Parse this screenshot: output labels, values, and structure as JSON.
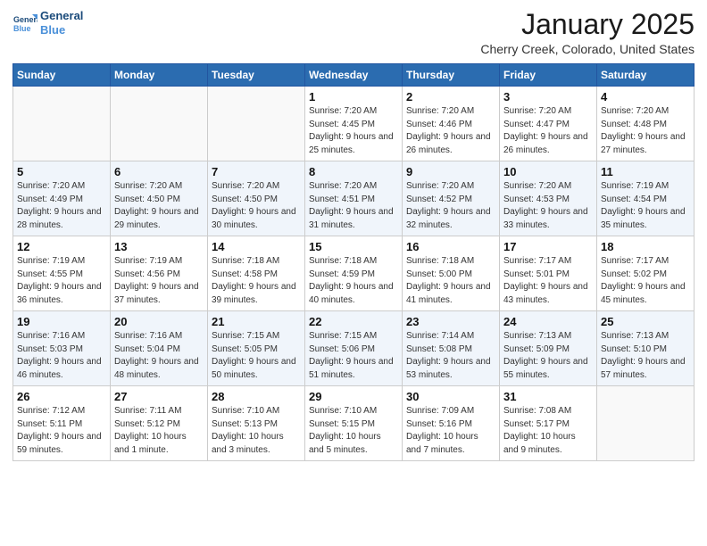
{
  "header": {
    "logo_line1": "General",
    "logo_line2": "Blue",
    "month": "January 2025",
    "location": "Cherry Creek, Colorado, United States"
  },
  "weekdays": [
    "Sunday",
    "Monday",
    "Tuesday",
    "Wednesday",
    "Thursday",
    "Friday",
    "Saturday"
  ],
  "weeks": [
    [
      {
        "day": "",
        "info": ""
      },
      {
        "day": "",
        "info": ""
      },
      {
        "day": "",
        "info": ""
      },
      {
        "day": "1",
        "info": "Sunrise: 7:20 AM\nSunset: 4:45 PM\nDaylight: 9 hours and 25 minutes."
      },
      {
        "day": "2",
        "info": "Sunrise: 7:20 AM\nSunset: 4:46 PM\nDaylight: 9 hours and 26 minutes."
      },
      {
        "day": "3",
        "info": "Sunrise: 7:20 AM\nSunset: 4:47 PM\nDaylight: 9 hours and 26 minutes."
      },
      {
        "day": "4",
        "info": "Sunrise: 7:20 AM\nSunset: 4:48 PM\nDaylight: 9 hours and 27 minutes."
      }
    ],
    [
      {
        "day": "5",
        "info": "Sunrise: 7:20 AM\nSunset: 4:49 PM\nDaylight: 9 hours and 28 minutes."
      },
      {
        "day": "6",
        "info": "Sunrise: 7:20 AM\nSunset: 4:50 PM\nDaylight: 9 hours and 29 minutes."
      },
      {
        "day": "7",
        "info": "Sunrise: 7:20 AM\nSunset: 4:50 PM\nDaylight: 9 hours and 30 minutes."
      },
      {
        "day": "8",
        "info": "Sunrise: 7:20 AM\nSunset: 4:51 PM\nDaylight: 9 hours and 31 minutes."
      },
      {
        "day": "9",
        "info": "Sunrise: 7:20 AM\nSunset: 4:52 PM\nDaylight: 9 hours and 32 minutes."
      },
      {
        "day": "10",
        "info": "Sunrise: 7:20 AM\nSunset: 4:53 PM\nDaylight: 9 hours and 33 minutes."
      },
      {
        "day": "11",
        "info": "Sunrise: 7:19 AM\nSunset: 4:54 PM\nDaylight: 9 hours and 35 minutes."
      }
    ],
    [
      {
        "day": "12",
        "info": "Sunrise: 7:19 AM\nSunset: 4:55 PM\nDaylight: 9 hours and 36 minutes."
      },
      {
        "day": "13",
        "info": "Sunrise: 7:19 AM\nSunset: 4:56 PM\nDaylight: 9 hours and 37 minutes."
      },
      {
        "day": "14",
        "info": "Sunrise: 7:18 AM\nSunset: 4:58 PM\nDaylight: 9 hours and 39 minutes."
      },
      {
        "day": "15",
        "info": "Sunrise: 7:18 AM\nSunset: 4:59 PM\nDaylight: 9 hours and 40 minutes."
      },
      {
        "day": "16",
        "info": "Sunrise: 7:18 AM\nSunset: 5:00 PM\nDaylight: 9 hours and 41 minutes."
      },
      {
        "day": "17",
        "info": "Sunrise: 7:17 AM\nSunset: 5:01 PM\nDaylight: 9 hours and 43 minutes."
      },
      {
        "day": "18",
        "info": "Sunrise: 7:17 AM\nSunset: 5:02 PM\nDaylight: 9 hours and 45 minutes."
      }
    ],
    [
      {
        "day": "19",
        "info": "Sunrise: 7:16 AM\nSunset: 5:03 PM\nDaylight: 9 hours and 46 minutes."
      },
      {
        "day": "20",
        "info": "Sunrise: 7:16 AM\nSunset: 5:04 PM\nDaylight: 9 hours and 48 minutes."
      },
      {
        "day": "21",
        "info": "Sunrise: 7:15 AM\nSunset: 5:05 PM\nDaylight: 9 hours and 50 minutes."
      },
      {
        "day": "22",
        "info": "Sunrise: 7:15 AM\nSunset: 5:06 PM\nDaylight: 9 hours and 51 minutes."
      },
      {
        "day": "23",
        "info": "Sunrise: 7:14 AM\nSunset: 5:08 PM\nDaylight: 9 hours and 53 minutes."
      },
      {
        "day": "24",
        "info": "Sunrise: 7:13 AM\nSunset: 5:09 PM\nDaylight: 9 hours and 55 minutes."
      },
      {
        "day": "25",
        "info": "Sunrise: 7:13 AM\nSunset: 5:10 PM\nDaylight: 9 hours and 57 minutes."
      }
    ],
    [
      {
        "day": "26",
        "info": "Sunrise: 7:12 AM\nSunset: 5:11 PM\nDaylight: 9 hours and 59 minutes."
      },
      {
        "day": "27",
        "info": "Sunrise: 7:11 AM\nSunset: 5:12 PM\nDaylight: 10 hours and 1 minute."
      },
      {
        "day": "28",
        "info": "Sunrise: 7:10 AM\nSunset: 5:13 PM\nDaylight: 10 hours and 3 minutes."
      },
      {
        "day": "29",
        "info": "Sunrise: 7:10 AM\nSunset: 5:15 PM\nDaylight: 10 hours and 5 minutes."
      },
      {
        "day": "30",
        "info": "Sunrise: 7:09 AM\nSunset: 5:16 PM\nDaylight: 10 hours and 7 minutes."
      },
      {
        "day": "31",
        "info": "Sunrise: 7:08 AM\nSunset: 5:17 PM\nDaylight: 10 hours and 9 minutes."
      },
      {
        "day": "",
        "info": ""
      }
    ]
  ]
}
